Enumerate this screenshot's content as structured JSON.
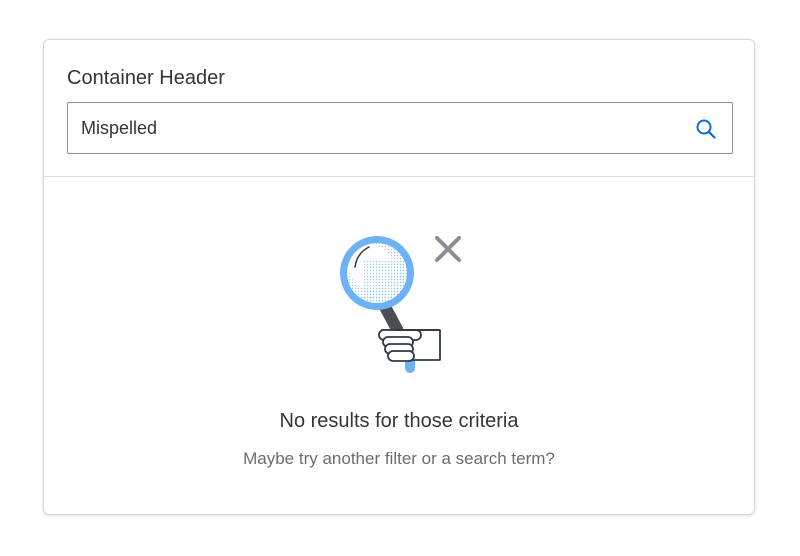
{
  "container": {
    "header_title": "Container Header",
    "search": {
      "value": "Mispelled",
      "icon": "search-icon"
    }
  },
  "empty_state": {
    "illustration": "no-search-results-illustration",
    "title": "No results for those criteria",
    "subtitle": "Maybe try another filter or a search term?"
  },
  "colors": {
    "accent": "#0a6ed1",
    "illustration_blue": "#6cb2f5",
    "text_primary": "#32363a",
    "text_secondary": "#6a6d70"
  }
}
